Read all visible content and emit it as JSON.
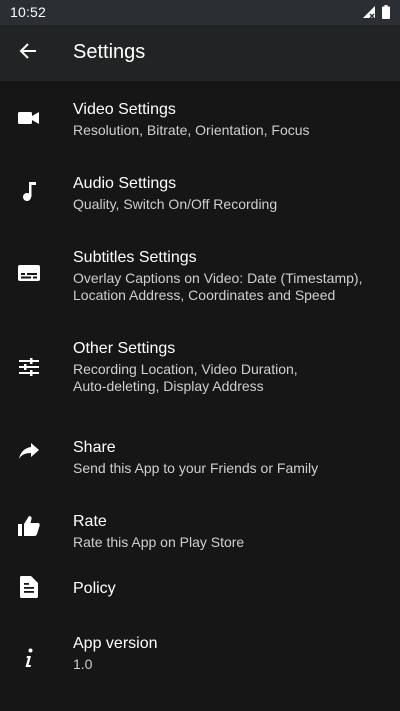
{
  "status_bar": {
    "time": "10:52"
  },
  "app_bar": {
    "title": "Settings"
  },
  "items": [
    {
      "title": "Video Settings",
      "subtitle": "Resolution, Bitrate, Orientation, Focus",
      "icon": "video-camera-icon"
    },
    {
      "title": "Audio Settings",
      "subtitle": "Quality, Switch On/Off Recording",
      "icon": "music-note-icon"
    },
    {
      "title": "Subtitles Settings",
      "subtitle": "Overlay Captions on Video: Date (Timestamp),\nLocation Address, Coordinates and Speed",
      "icon": "subtitles-icon"
    },
    {
      "title": "Other Settings",
      "subtitle": "Recording Location, Video Duration,\nAuto-deleting, Display Address",
      "icon": "tune-icon"
    },
    {
      "title": "Share",
      "subtitle": "Send this App to your Friends or Family",
      "icon": "share-arrow-icon"
    },
    {
      "title": "Rate",
      "subtitle": "Rate this App on Play Store",
      "icon": "thumb-up-icon"
    },
    {
      "title": "Policy",
      "subtitle": "",
      "icon": "document-icon"
    },
    {
      "title": "App version",
      "subtitle": "1.0",
      "icon": "info-icon"
    }
  ]
}
